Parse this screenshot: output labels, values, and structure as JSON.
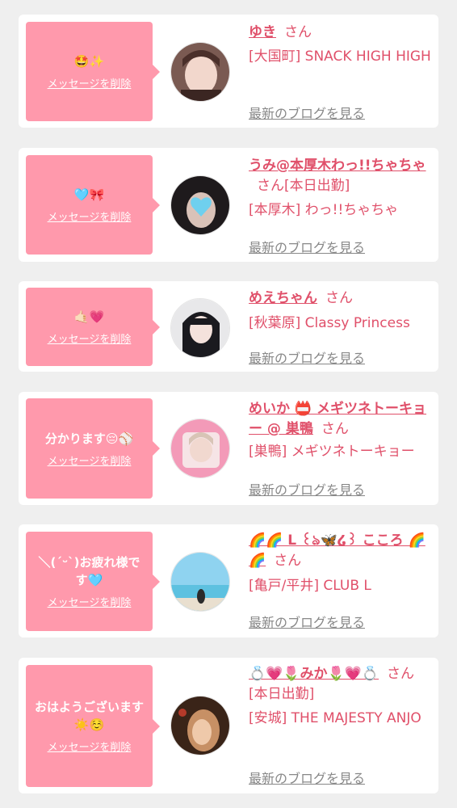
{
  "delete_label": "メッセージを削除",
  "blog_label": "最新のブログを見る",
  "san": "さん",
  "colors": {
    "bubble": "#ff99ac",
    "accent": "#e0506a",
    "link_gray": "#888888",
    "background": "#efefef"
  },
  "items": [
    {
      "message": "🤩✨",
      "name": "ゆき",
      "tag": "",
      "shop": "[大国町] SNACK HIGH HIGH"
    },
    {
      "message": "🩵🎀",
      "name": "うみ@本厚木わっ!!ちゃちゃ",
      "tag": "[本日出勤]",
      "shop": "[本厚木] わっ!!ちゃちゃ"
    },
    {
      "message": "🤙🏻💗",
      "name": "めえちゃん",
      "tag": "",
      "shop": "[秋葉原] Classy Princess"
    },
    {
      "message": "分かります😔⚾",
      "name": "めいか 📛 メギツネトーキョー @ 巣鴨",
      "tag": "",
      "shop": "[巣鴨] メギツネトーキョー"
    },
    {
      "message": "＼(ˊᵕˋ)お疲れ様です🩵",
      "name": "🌈🌈 L ꒰ঌ🦋໒꒱ こころ 🌈🌈",
      "tag": "",
      "shop": "[亀戸/平井] CLUB L"
    },
    {
      "message": "おはようございます☀️☺️",
      "name": "💍💗🌷みか🌷💗💍",
      "tag": "[本日出勤]",
      "shop": "[安城] THE MAJESTY ANJO"
    }
  ]
}
